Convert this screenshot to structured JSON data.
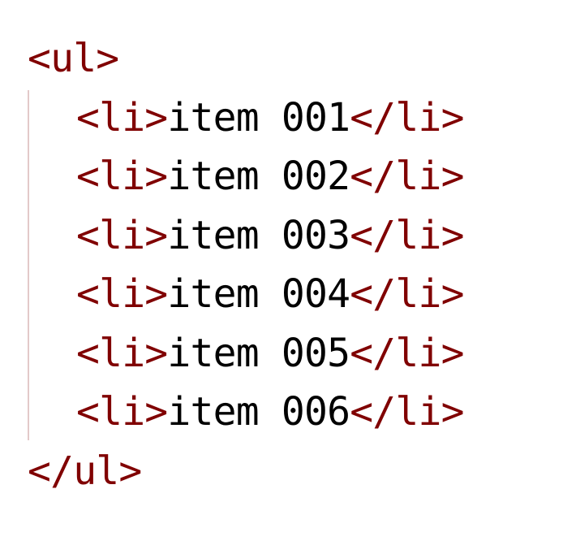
{
  "code": {
    "open_tag": "<ul>",
    "close_tag": "</ul>",
    "items": [
      {
        "open": "<li>",
        "text": "item 001",
        "close": "</li>"
      },
      {
        "open": "<li>",
        "text": "item 002",
        "close": "</li>"
      },
      {
        "open": "<li>",
        "text": "item 003",
        "close": "</li>"
      },
      {
        "open": "<li>",
        "text": "item 004",
        "close": "</li>"
      },
      {
        "open": "<li>",
        "text": "item 005",
        "close": "</li>"
      },
      {
        "open": "<li>",
        "text": "item 006",
        "close": "</li>"
      }
    ]
  },
  "colors": {
    "tag": "#800000",
    "text": "#000000",
    "indent_guide": "#e3c9c9",
    "background": "#ffffff"
  }
}
